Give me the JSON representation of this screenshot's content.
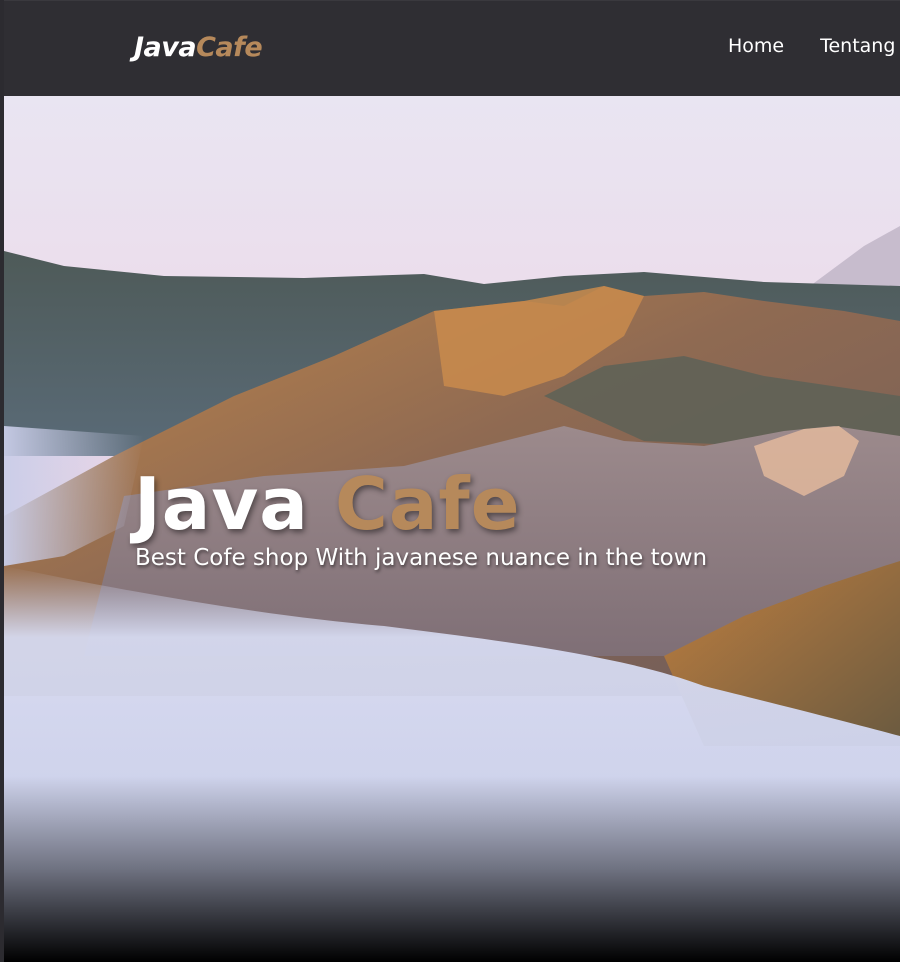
{
  "navbar": {
    "logo_part1": "Java",
    "logo_part2": "Cafe",
    "links": [
      {
        "label": "Home"
      },
      {
        "label": "Tentang Kami"
      }
    ]
  },
  "hero": {
    "title_part1": "Java",
    "title_part2": "Cafe",
    "subtitle": "Best Cofe shop With javanese nuance in the town"
  },
  "colors": {
    "navbar_bg": "#2f2e33",
    "accent": "#b6895b",
    "text": "#ffffff"
  }
}
